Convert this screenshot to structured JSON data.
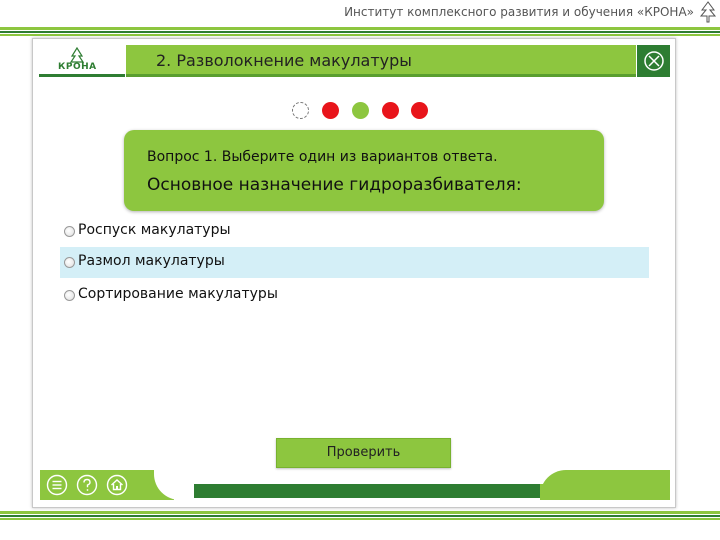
{
  "header": {
    "institute_title": "Институт комплексного развития и обучения «КРОНА»"
  },
  "logo": {
    "text": "КРОНА"
  },
  "slide": {
    "title": "2. Разволокнение макулатуры"
  },
  "progress": {
    "dots": [
      "current",
      "wrong",
      "correct",
      "wrong",
      "wrong"
    ]
  },
  "question": {
    "label": "Вопрос 1. Выберите один из вариантов ответа.",
    "text": "Основное назначение гидроразбивателя:"
  },
  "options": [
    {
      "label": "Роспуск макулатуры",
      "highlighted": false
    },
    {
      "label": "Размол макулатуры",
      "highlighted": true
    },
    {
      "label": "Сортирование макулатуры",
      "highlighted": false
    }
  ],
  "actions": {
    "check_label": "Проверить"
  },
  "colors": {
    "accent_green": "#8dc63f",
    "dark_green": "#2e7d32",
    "wrong_red": "#e8151b",
    "highlight": "#d4eff7"
  },
  "footer": {
    "icons": [
      "menu-icon",
      "help-icon",
      "home-icon"
    ]
  }
}
